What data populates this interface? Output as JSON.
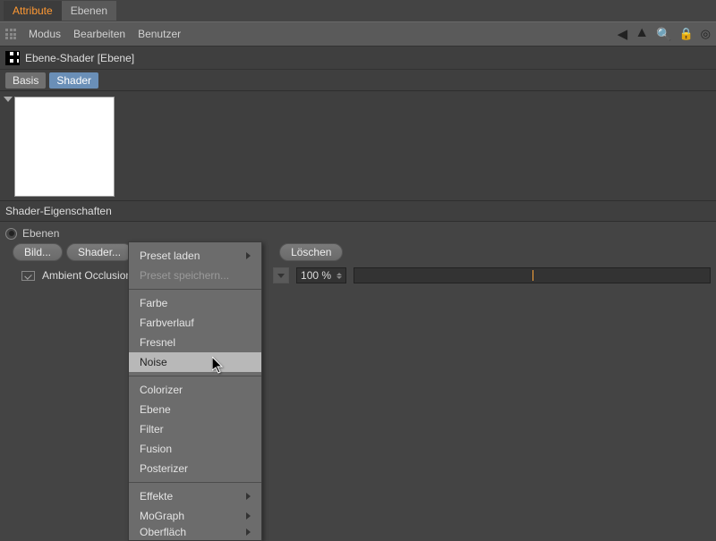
{
  "top_tabs": {
    "attribute": "Attribute",
    "layers": "Ebenen"
  },
  "menu": {
    "mode": "Modus",
    "edit": "Bearbeiten",
    "user": "Benutzer"
  },
  "object": {
    "title": "Ebene-Shader [Ebene]"
  },
  "sub_tabs": {
    "basic": "Basis",
    "shader": "Shader"
  },
  "section": {
    "title": "Shader-Eigenschaften"
  },
  "props": {
    "layers_label": "Ebenen",
    "image_btn": "Bild...",
    "shader_btn": "Shader...",
    "delete_btn": "Löschen",
    "shader_name": "Ambient Occlusion",
    "percent": "100 %"
  },
  "menu_items": {
    "load_preset": "Preset laden",
    "save_preset": "Preset speichern...",
    "color": "Farbe",
    "gradient": "Farbverlauf",
    "fresnel": "Fresnel",
    "noise": "Noise",
    "colorizer": "Colorizer",
    "layer": "Ebene",
    "filter": "Filter",
    "fusion": "Fusion",
    "posterizer": "Posterizer",
    "effects": "Effekte",
    "mograph": "MoGraph",
    "last_cut": "Oberfläch"
  }
}
